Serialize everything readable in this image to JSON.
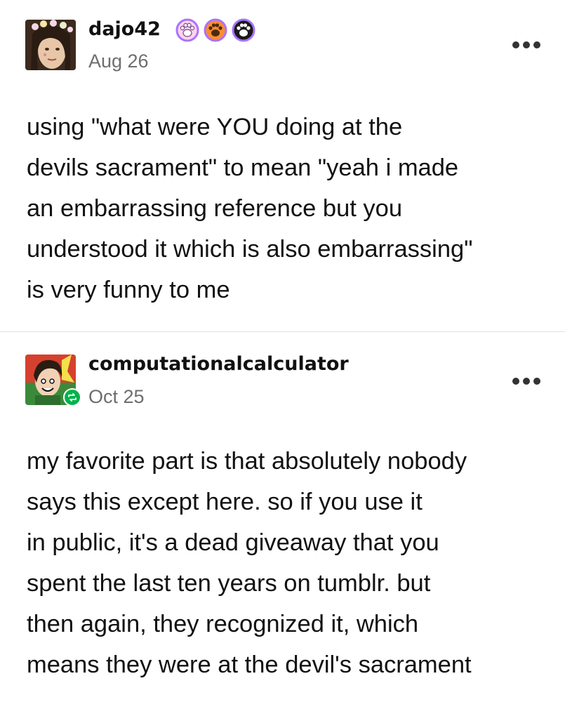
{
  "posts": [
    {
      "username": "dajo42",
      "date": "Aug 26",
      "badges": [
        "paw-badge-pink",
        "paw-badge-orange",
        "paw-badge-black"
      ],
      "text": "using \"what were YOU doing at the\ndevils sacrament\" to mean \"yeah i made\nan embarrassing reference but you\nunderstood it which is also embarrassing\"\nis very funny to me"
    },
    {
      "username": "computationalcalculator",
      "date": "Oct 25",
      "reblog_icon": "reblog-icon",
      "text": "my favorite part is that absolutely nobody\nsays this except here. so if you use it\nin public, it's a dead giveaway that you\nspent the last ten years on tumblr. but\nthen again, they recognized it, which\nmeans they were at the devil's sacrament"
    }
  ],
  "colors": {
    "text": "#111111",
    "date": "#6e6e6e",
    "badge_purple": "#a774ff",
    "badge_pink": "#ffb8e0",
    "badge_orange": "#ff8c2e",
    "reblog_green": "#00b34a"
  }
}
